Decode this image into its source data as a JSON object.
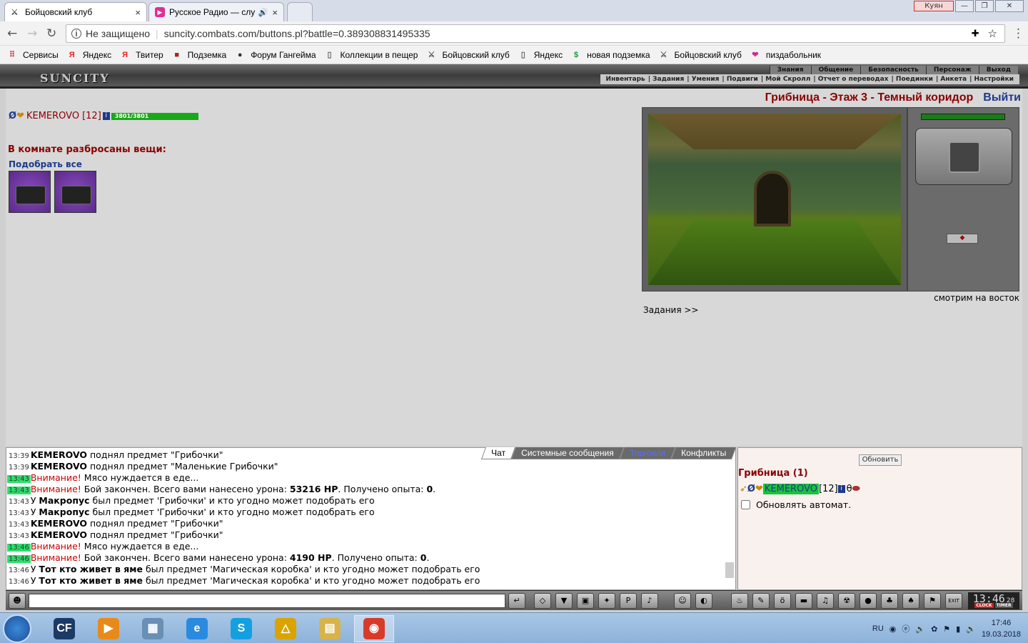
{
  "browser": {
    "tabs": [
      {
        "title": "Бойцовский клуб",
        "close": "×"
      },
      {
        "title": "Русское Радио — слу",
        "close": "×"
      }
    ],
    "user_badge": "Куян",
    "address": {
      "security": "Не защищено",
      "url": "suncity.combats.com/buttons.pl?battle=0.389308831495335"
    },
    "bookmarks": [
      {
        "label": "Сервисы",
        "icon": "apps-grid-icon"
      },
      {
        "label": "Яндекс",
        "icon": "yandex-icon"
      },
      {
        "label": "Твитер",
        "icon": "yandex-icon"
      },
      {
        "label": "Подземка",
        "icon": "dungeon-icon"
      },
      {
        "label": "Форум Гангейма",
        "icon": "globe-icon"
      },
      {
        "label": "Коллекции в пещер",
        "icon": "page-icon"
      },
      {
        "label": "Бойцовский клуб",
        "icon": "crossed-swords-icon"
      },
      {
        "label": "Яндекс",
        "icon": "page-icon"
      },
      {
        "label": "новая подземка",
        "icon": "green-dollar-icon"
      },
      {
        "label": "Бойцовский клуб",
        "icon": "crossed-swords-icon"
      },
      {
        "label": "пиздабольник",
        "icon": "heart-icon"
      }
    ]
  },
  "game": {
    "logo": "SUNCITY",
    "menu_top": [
      "Знания",
      "Общение",
      "Безопасность",
      "Персонаж",
      "Выход"
    ],
    "menu_bottom": [
      "Инвентарь",
      "Задания",
      "Умения",
      "Подвиги",
      "Мой Скролл",
      "Отчет о переводах",
      "Поединки",
      "Анкета",
      "Настройки"
    ],
    "location": "Грибница - Этаж 3 - Темный коридор",
    "exit_label": "Выйти",
    "player": {
      "name": "KEMEROVO",
      "level": "[12]",
      "hp_text": "3801/3801",
      "hp_fraction": 1.0
    },
    "items_title": "В комнате разбросаны вещи:",
    "pick_all": "Подобрать все",
    "facing": "смотрим на восток",
    "tasks_link": "Задания >>"
  },
  "chat": {
    "tabs": [
      "Чат",
      "Системные сообщения",
      "Торговля",
      "Конфликты"
    ],
    "lines": [
      {
        "time": "13:39",
        "hl": false,
        "parts": [
          {
            "t": "KEMEROVO",
            "s": "b"
          },
          {
            "t": " поднял предмет \"Грибочки\"",
            "s": ""
          }
        ]
      },
      {
        "time": "13:39",
        "hl": false,
        "parts": [
          {
            "t": "KEMEROVO",
            "s": "b"
          },
          {
            "t": " поднял предмет \"Маленькие Грибочки\"",
            "s": ""
          }
        ]
      },
      {
        "time": "13:43",
        "hl": true,
        "parts": [
          {
            "t": "Внимание!",
            "s": "warn"
          },
          {
            "t": " Мясо нуждается в еде...",
            "s": ""
          }
        ]
      },
      {
        "time": "13:43",
        "hl": true,
        "parts": [
          {
            "t": "Внимание!",
            "s": "warn"
          },
          {
            "t": " Бой закончен. Всего вами нанесено урона: ",
            "s": ""
          },
          {
            "t": "53216 HP",
            "s": "b"
          },
          {
            "t": ". Получено опыта: ",
            "s": ""
          },
          {
            "t": "0",
            "s": "b"
          },
          {
            "t": ".",
            "s": ""
          }
        ]
      },
      {
        "time": "13:43",
        "hl": false,
        "parts": [
          {
            "t": "У ",
            "s": ""
          },
          {
            "t": "Макропус",
            "s": "b"
          },
          {
            "t": " был предмет 'Грибочки' и кто угодно может подобрать его",
            "s": ""
          }
        ]
      },
      {
        "time": "13:43",
        "hl": false,
        "parts": [
          {
            "t": "У ",
            "s": ""
          },
          {
            "t": "Макропус",
            "s": "b"
          },
          {
            "t": " был предмет 'Грибочки' и кто угодно может подобрать его",
            "s": ""
          }
        ]
      },
      {
        "time": "13:43",
        "hl": false,
        "parts": [
          {
            "t": "KEMEROVO",
            "s": "b"
          },
          {
            "t": " поднял предмет \"Грибочки\"",
            "s": ""
          }
        ]
      },
      {
        "time": "13:43",
        "hl": false,
        "parts": [
          {
            "t": "KEMEROVO",
            "s": "b"
          },
          {
            "t": " поднял предмет \"Грибочки\"",
            "s": ""
          }
        ]
      },
      {
        "time": "13:46",
        "hl": true,
        "parts": [
          {
            "t": "Внимание!",
            "s": "warn"
          },
          {
            "t": " Мясо нуждается в еде...",
            "s": ""
          }
        ]
      },
      {
        "time": "13:46",
        "hl": true,
        "parts": [
          {
            "t": "Внимание!",
            "s": "warn"
          },
          {
            "t": " Бой закончен. Всего вами нанесено урона: ",
            "s": ""
          },
          {
            "t": "4190 HP",
            "s": "b"
          },
          {
            "t": ". Получено опыта: ",
            "s": ""
          },
          {
            "t": "0",
            "s": "b"
          },
          {
            "t": ".",
            "s": ""
          }
        ]
      },
      {
        "time": "13:46",
        "hl": false,
        "parts": [
          {
            "t": "У ",
            "s": ""
          },
          {
            "t": "Тот кто живет в яме",
            "s": "b"
          },
          {
            "t": " был предмет 'Магическая коробка' и кто угодно может подобрать его",
            "s": ""
          }
        ]
      },
      {
        "time": "13:46",
        "hl": false,
        "parts": [
          {
            "t": "У ",
            "s": ""
          },
          {
            "t": "Тот кто живет в яме",
            "s": "b"
          },
          {
            "t": " был предмет 'Магическая коробка' и кто угодно может подобрать его",
            "s": ""
          }
        ]
      }
    ]
  },
  "room": {
    "refresh": "Обновить",
    "title": "Грибница (1)",
    "user_name": "KEMEROVO",
    "user_level": "[12]",
    "auto_update": "Обновлять автомат."
  },
  "clock": {
    "time": "13:46",
    "sec": "28",
    "label_a": "CLOCK",
    "label_b": "TIMER"
  },
  "taskbar": {
    "apps": [
      {
        "label": "CF",
        "icon": "cf-app-icon",
        "color": "#1b3a66"
      },
      {
        "label": "▶",
        "icon": "media-player-icon",
        "color": "#e88a1a"
      },
      {
        "label": "▦",
        "icon": "calculator-icon",
        "color": "#6a8fb5"
      },
      {
        "label": "e",
        "icon": "ie-icon",
        "color": "#2a8ae0"
      },
      {
        "label": "S",
        "icon": "skype-icon",
        "color": "#14a0e0"
      },
      {
        "label": "△",
        "icon": "launcher-icon",
        "color": "#d9a400"
      },
      {
        "label": "▤",
        "icon": "explorer-icon",
        "color": "#d8b24a"
      },
      {
        "label": "◉",
        "icon": "chrome-icon",
        "color": "#d83a2a"
      }
    ],
    "lang": "RU",
    "time": "17:46",
    "date": "19.03.2018"
  }
}
